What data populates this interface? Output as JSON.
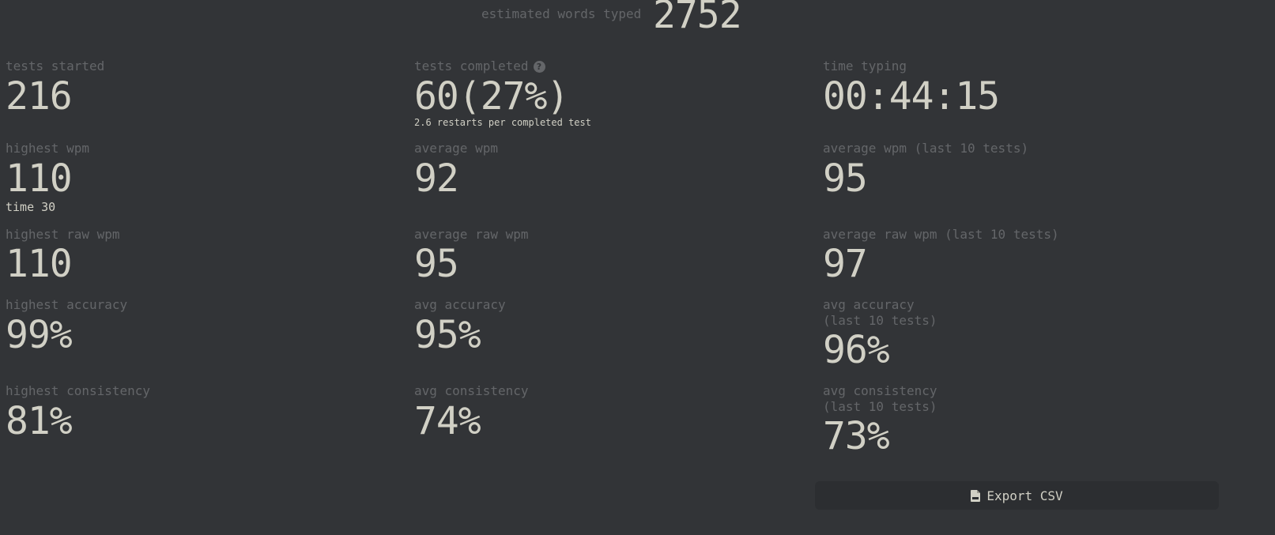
{
  "header": {
    "estimated_label": "estimated words typed",
    "estimated_value": "2752"
  },
  "stats": {
    "tests_started": {
      "label": "tests started",
      "value": "216"
    },
    "tests_completed": {
      "label": "tests completed",
      "value": "60(27%)",
      "note": "2.6 restarts per completed test"
    },
    "time_typing": {
      "label": "time typing",
      "value": "00:44:15"
    },
    "highest_wpm": {
      "label": "highest wpm",
      "value": "110",
      "note": "time 30"
    },
    "average_wpm": {
      "label": "average wpm",
      "value": "92"
    },
    "average_wpm_last10": {
      "label": "average wpm (last 10 tests)",
      "value": "95"
    },
    "highest_raw_wpm": {
      "label": "highest raw wpm",
      "value": "110"
    },
    "average_raw_wpm": {
      "label": "average raw wpm",
      "value": "95"
    },
    "average_raw_wpm_last10": {
      "label": "average raw wpm (last 10 tests)",
      "value": "97"
    },
    "highest_accuracy": {
      "label": "highest accuracy",
      "value": "99%"
    },
    "avg_accuracy": {
      "label": "avg accuracy",
      "value": "95%"
    },
    "avg_accuracy_last10": {
      "label": "avg accuracy",
      "label2": "(last 10 tests)",
      "value": "96%"
    },
    "highest_consistency": {
      "label": "highest consistency",
      "value": "81%"
    },
    "avg_consistency": {
      "label": "avg consistency",
      "value": "74%"
    },
    "avg_consistency_last10": {
      "label": "avg consistency",
      "label2": "(last 10 tests)",
      "value": "73%"
    }
  },
  "export": {
    "label": "Export CSV",
    "icon": "file-csv-icon"
  },
  "colors": {
    "background": "#323437",
    "text": "#d1d0c5",
    "sub": "#646669",
    "button": "#2c2e31"
  }
}
